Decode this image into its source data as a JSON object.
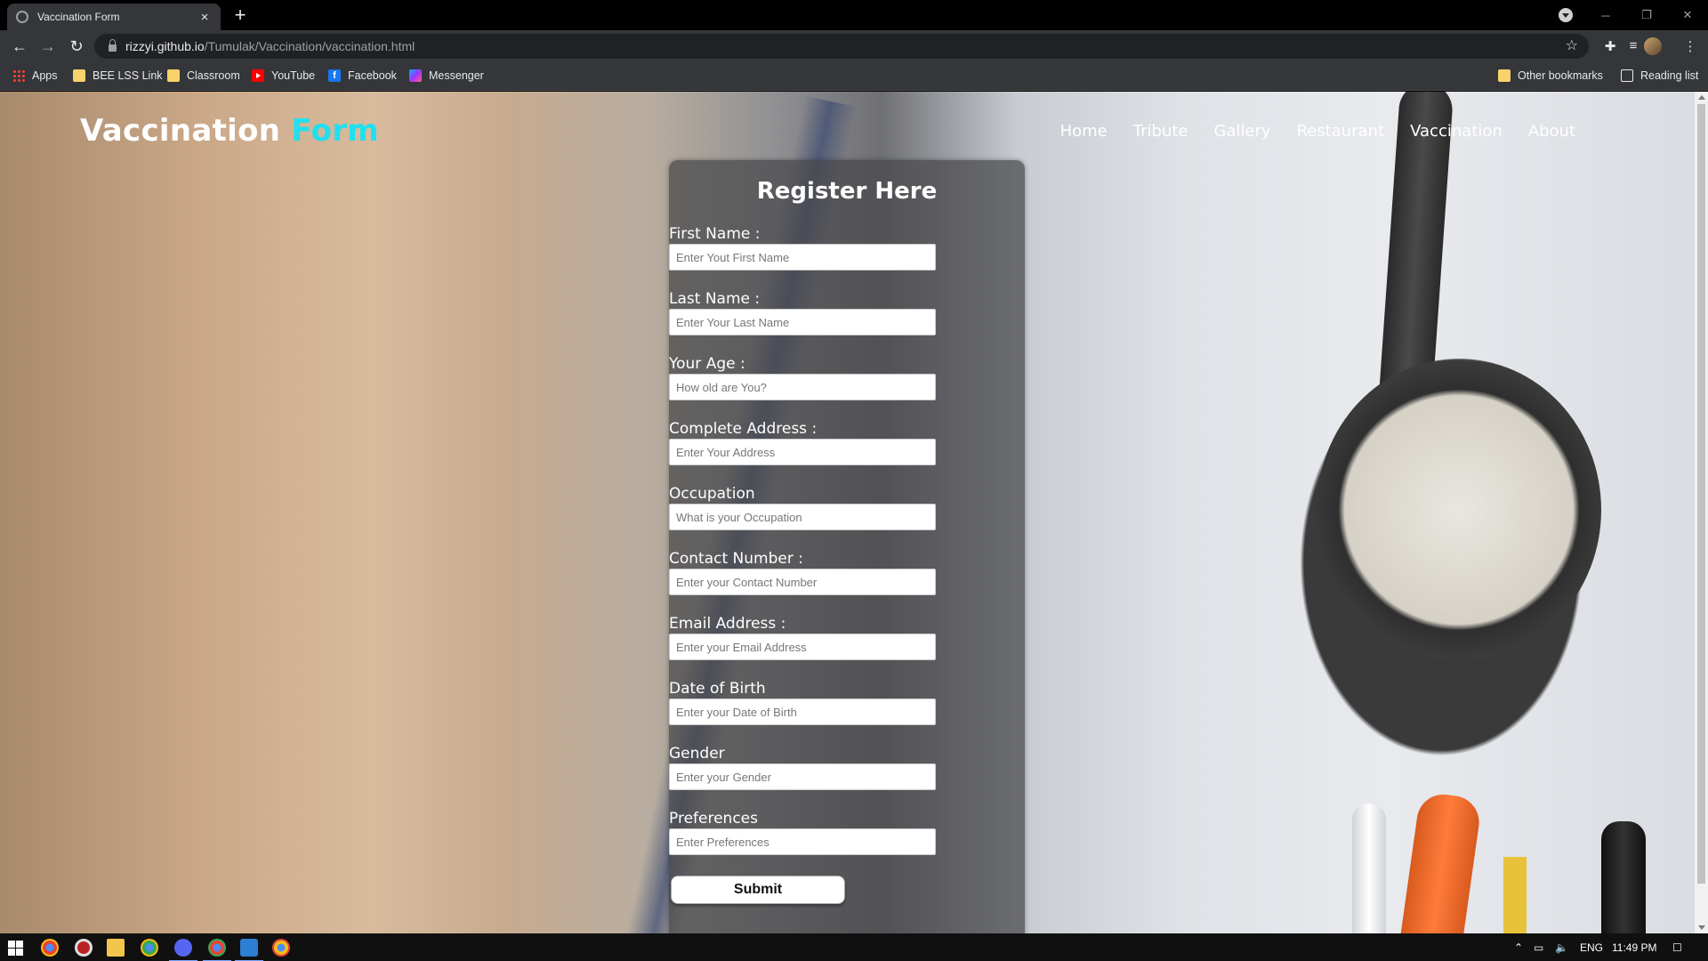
{
  "browser": {
    "tab_title": "Vaccination Form",
    "tab_close": "×",
    "new_tab": "+",
    "url_host": "rizzyi.github.io",
    "url_path": "/Tumulak/Vaccination/vaccination.html",
    "window_controls": {
      "minimize": "─",
      "restore": "❐",
      "close": "✕"
    }
  },
  "bookmarks": {
    "items": [
      {
        "label": "Apps",
        "icon": "apps-icon"
      },
      {
        "label": "BEE LSS Link",
        "icon": "folder-icon"
      },
      {
        "label": "Classroom",
        "icon": "folder-icon"
      },
      {
        "label": "YouTube",
        "icon": "youtube-icon"
      },
      {
        "label": "Facebook",
        "icon": "facebook-icon"
      },
      {
        "label": "Messenger",
        "icon": "messenger-icon"
      }
    ],
    "other": "Other bookmarks",
    "reading_list": "Reading list"
  },
  "site": {
    "logo_main": "Vaccination",
    "logo_accent": "Form",
    "accent_color": "#1fe0f0",
    "nav": [
      "Home",
      "Tribute",
      "Gallery",
      "Restaurant",
      "Vaccination",
      "About"
    ]
  },
  "form": {
    "title": "Register Here",
    "fields": [
      {
        "label": "First Name :",
        "placeholder": "Enter Yout First Name"
      },
      {
        "label": "Last Name :",
        "placeholder": "Enter Your Last Name"
      },
      {
        "label": "Your Age :",
        "placeholder": "How old are You?"
      },
      {
        "label": "Complete Address :",
        "placeholder": "Enter Your Address"
      },
      {
        "label": "Occupation",
        "placeholder": "What is your Occupation"
      },
      {
        "label": "Contact Number :",
        "placeholder": "Enter your Contact Number"
      },
      {
        "label": "Email Address :",
        "placeholder": "Enter your Email Address"
      },
      {
        "label": "Date of Birth",
        "placeholder": "Enter your Date of Birth"
      },
      {
        "label": "Gender",
        "placeholder": "Enter your Gender"
      },
      {
        "label": "Preferences",
        "placeholder": "Enter Preferences"
      }
    ],
    "submit_label": "Submit"
  },
  "taskbar": {
    "language": "ENG",
    "time": "11:49 PM"
  }
}
